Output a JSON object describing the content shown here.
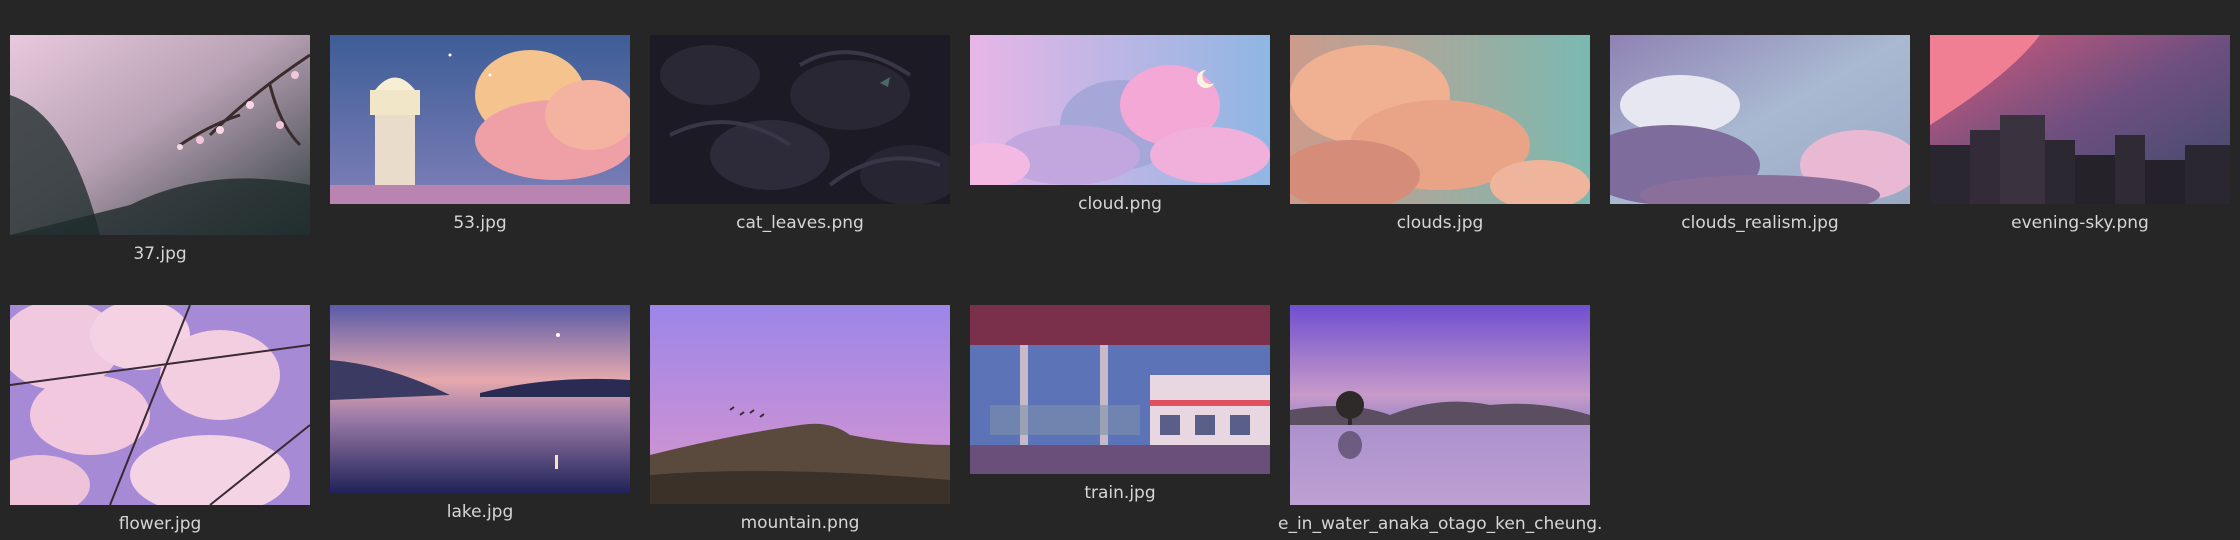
{
  "files": [
    {
      "id": "37",
      "name": "37.jpg"
    },
    {
      "id": "53",
      "name": "53.jpg"
    },
    {
      "id": "cat-leaves",
      "name": "cat_leaves.png"
    },
    {
      "id": "cloud",
      "name": "cloud.png"
    },
    {
      "id": "clouds",
      "name": "clouds.jpg"
    },
    {
      "id": "clouds-realism",
      "name": "clouds_realism.jpg"
    },
    {
      "id": "evening-sky",
      "name": "evening-sky.png"
    },
    {
      "id": "flower",
      "name": "flower.jpg"
    },
    {
      "id": "lake",
      "name": "lake.jpg"
    },
    {
      "id": "mountain",
      "name": "mountain.png"
    },
    {
      "id": "train",
      "name": "train.jpg"
    },
    {
      "id": "tree-in-water",
      "name": "e_in_water_anaka_otago_ken_cheung."
    }
  ]
}
